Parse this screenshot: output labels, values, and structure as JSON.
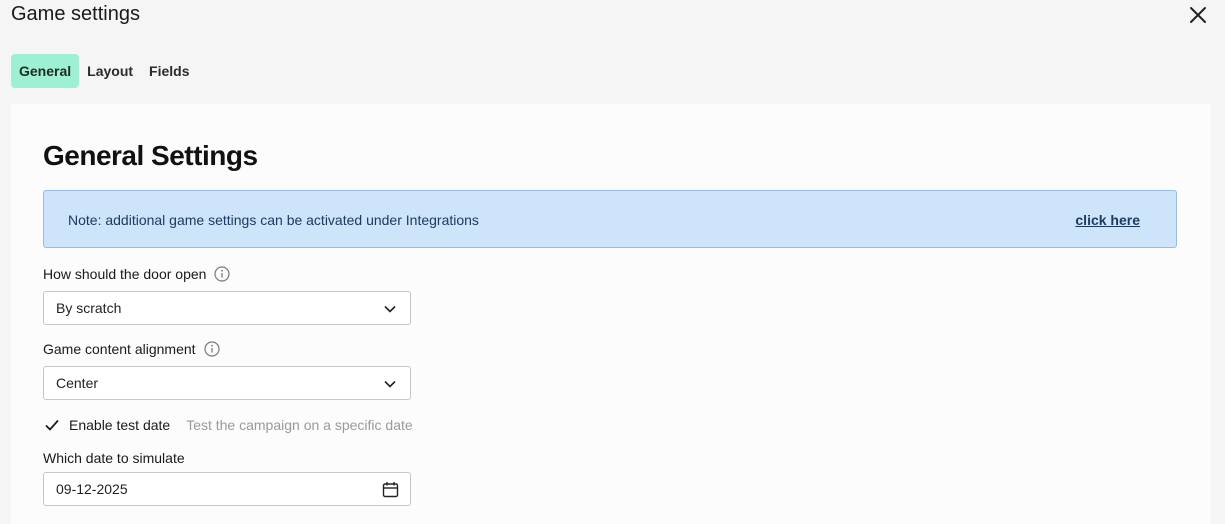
{
  "window": {
    "title": "Game settings",
    "close_icon": "close-icon"
  },
  "tabs": [
    {
      "label": "General",
      "active": true
    },
    {
      "label": "Layout",
      "active": false
    },
    {
      "label": "Fields",
      "active": false
    }
  ],
  "general": {
    "heading": "General Settings",
    "note": {
      "text": "Note: additional game settings can be activated under Integrations",
      "link": "click here"
    },
    "door_open": {
      "label": "How should the door open",
      "value": "By scratch",
      "icon": "info-icon"
    },
    "alignment": {
      "label": "Game content alignment",
      "value": "Center",
      "icon": "info-icon"
    },
    "test_date": {
      "checked": true,
      "label": "Enable test date",
      "hint": "Test the campaign on a specific date"
    },
    "simulate_date": {
      "label": "Which date to simulate",
      "value": "09-12-2025",
      "icon": "calendar-icon"
    }
  },
  "colors": {
    "active_tab": "#9ef0d2",
    "note_bg": "#cde4fa",
    "note_border": "#92bde8",
    "note_text": "#1f3a62"
  }
}
